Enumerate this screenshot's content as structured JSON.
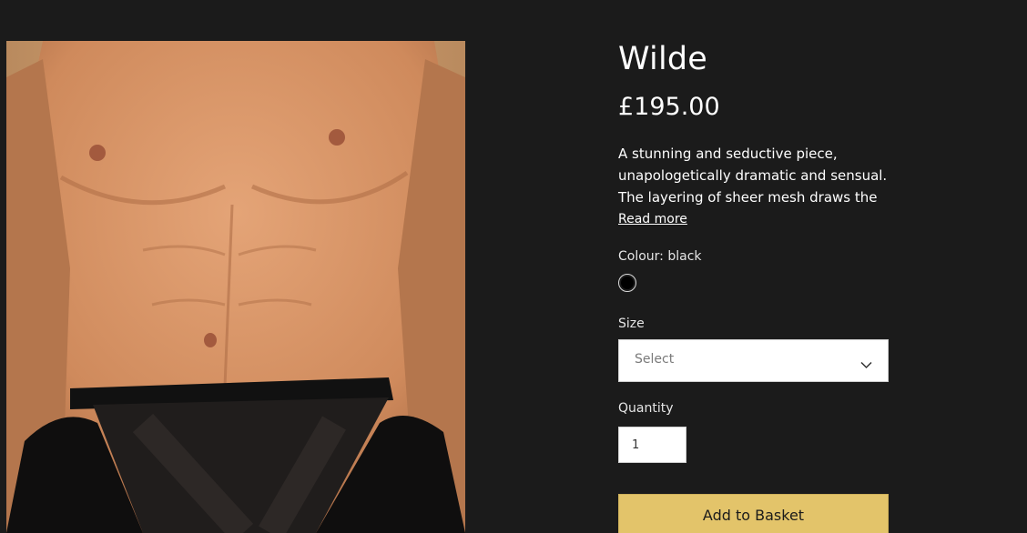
{
  "product": {
    "title": "Wilde",
    "price": "£195.00",
    "description": "A stunning and seductive piece, unapologetically dramatic and sensual. The layering of sheer mesh draws the",
    "read_more_label": "Read more",
    "colour_label": "Colour: black",
    "colour_swatch": "#000000",
    "size_label": "Size",
    "size_placeholder": "Select",
    "quantity_label": "Quantity",
    "quantity_value": "1",
    "add_to_basket_label": "Add to Basket"
  },
  "colors": {
    "background": "#1b1b1b",
    "button": "#e3c46a",
    "text": "#ffffff"
  },
  "icons": {
    "dropdown": "chevron-down-icon"
  }
}
